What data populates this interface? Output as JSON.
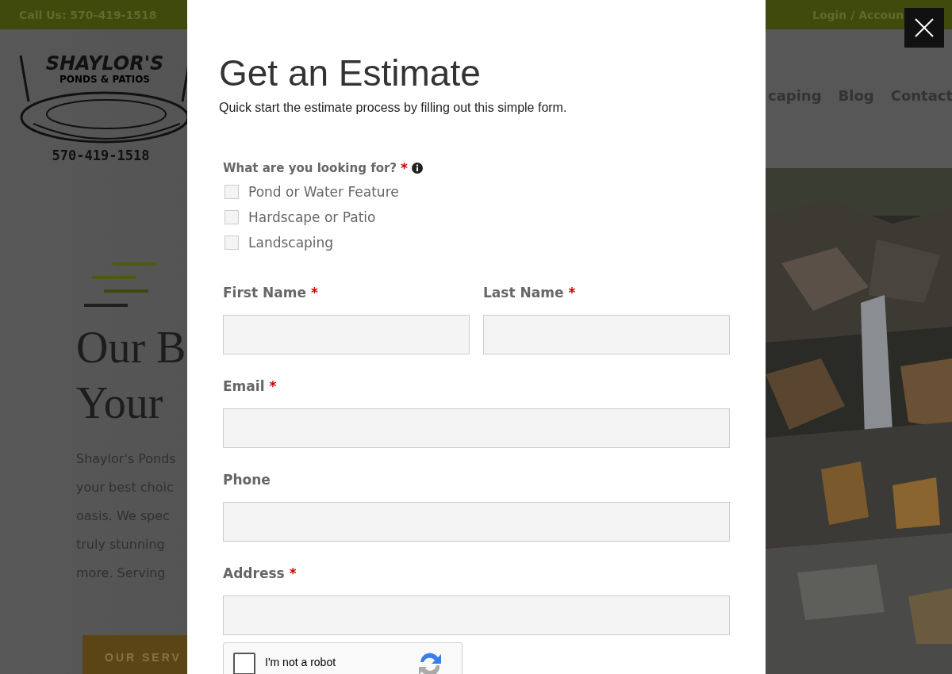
{
  "top_bar": {
    "phone": "Call Us: 570-419-1518",
    "account_link": "Login / Accoun"
  },
  "logo": {
    "name": "SHAYLOR'S",
    "tagline": "PONDS & PATIOS",
    "phone": "570-419-1518"
  },
  "nav": [
    "caping",
    "Blog",
    "Contact"
  ],
  "hero": {
    "heading_lines": [
      "Our B",
      "Your"
    ],
    "body_lines": [
      "Shaylor's Ponds",
      "your best choic",
      "oasis.  We spec",
      "truly stunning",
      "more.  Serving"
    ],
    "button": "OUR SERV",
    "picture": {
      "kind": "picture"
    }
  },
  "modal": {
    "title": "Get an Estimate",
    "subtitle": "Quick start the estimate process by filling out this simple form.",
    "interest": {
      "label": "What are you looking for?",
      "required_mark": "*",
      "options": [
        {
          "label": "Pond or Water Feature",
          "checked": false
        },
        {
          "label": "Hardscape or Patio",
          "checked": false
        },
        {
          "label": "Landscaping",
          "checked": false
        }
      ]
    },
    "fields": [
      {
        "label": "First Name",
        "required_mark": "*",
        "kind": "half"
      },
      {
        "label": "Last Name",
        "required_mark": "*",
        "kind": "half"
      },
      {
        "label": "Email",
        "required_mark": "*",
        "kind": "full"
      },
      {
        "label": "Phone",
        "kind": "full"
      },
      {
        "label": "Address",
        "required_mark": "*",
        "kind": "full"
      }
    ],
    "captcha": {
      "label": "I'm not a robot",
      "checked": false
    }
  }
}
